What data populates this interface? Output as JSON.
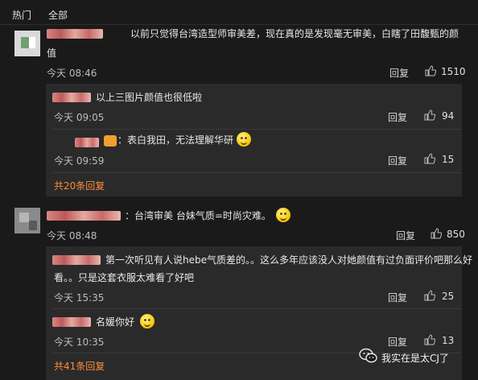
{
  "tabs": {
    "hot": "热门",
    "all": "全部"
  },
  "comments": [
    {
      "text_line1": "以前只觉得台湾造型师审美差，现在真的是发现毫无审美，白瞎了田馥甄的颜",
      "text_line2": "值",
      "time": "今天 08:46",
      "reply": "回复",
      "likes": "1510",
      "replies": [
        {
          "text": "以上三图片颜值也很低啦",
          "time": "今天 09:05",
          "reply": "回复",
          "likes": "94"
        },
        {
          "text": "：表白我田，无法理解华研",
          "time": "今天 09:59",
          "reply": "回复",
          "likes": "15"
        }
      ],
      "more": "共20条回复"
    },
    {
      "text": "：台湾审美 台妹气质=时尚灾难。",
      "time": "今天 08:48",
      "reply": "回复",
      "likes": "850",
      "replies": [
        {
          "text_line1": "第一次听见有人说hebe气质差的。。这么多年应该没人对她颜值有过负面评价吧那么好",
          "text_line2": "看。。只是这套衣服太难看了好吧",
          "time": "今天 15:35",
          "reply": "回复",
          "likes": "25"
        },
        {
          "text": "名媛你好",
          "time": "今天 10:35",
          "reply": "回复",
          "likes": "13"
        }
      ],
      "more": "共41条回复"
    }
  ],
  "watermark": {
    "text": "我实在是太CJ了",
    "icon": "wechat-icon"
  }
}
